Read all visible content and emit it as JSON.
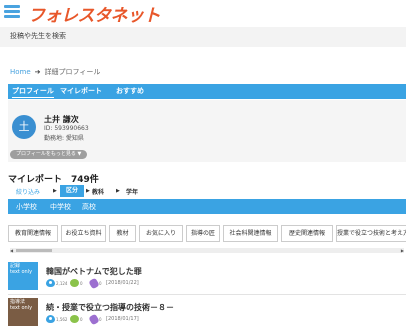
{
  "header": {
    "logo": "フォレスタネット"
  },
  "search": {
    "placeholder": "投稿や先生を検索"
  },
  "breadcrumb": {
    "home": "Home",
    "separator": "➔",
    "current": "詳細プロフィール"
  },
  "tabs": [
    {
      "label": "プロフィール",
      "active": true
    },
    {
      "label": "マイレポート",
      "active": false
    },
    {
      "label": "おすすめ",
      "active": false
    }
  ],
  "profile": {
    "avatar_letter": "土",
    "name": "土井 謙次",
    "id_text": "ID: 593990663",
    "pref_text": "勤務地: 愛知県",
    "more_label": "プロフィールをもっと見る ▼"
  },
  "myreport": {
    "heading": "マイレポート　749件",
    "filter_label": "絞り込み",
    "filter_active": "区分",
    "filter_kyoka": "教科",
    "filter_gakunen": "学年",
    "arrow": "▶"
  },
  "schools": [
    "小学校",
    "中学校",
    "高校"
  ],
  "tags": [
    "教育関連情報",
    "お役立ち資料",
    "教材",
    "お気に入り",
    "指導の匠",
    "社会科関連情報",
    "歴史関連情報",
    "授業で役立つ技術と考え方"
  ],
  "scrollbar": {
    "left": "◀",
    "right": "▶"
  },
  "posts": [
    {
      "thumb_line1": "記録",
      "thumb_line2": "text only",
      "title": "韓国がベトナムで犯した罪",
      "views": "2,124",
      "likes": "0",
      "clips": "0",
      "date": "[2018/01/22]"
    },
    {
      "thumb_line1": "指導法",
      "thumb_line2": "text only",
      "title": "続・授業で役立つ指導の技術－８－",
      "views": "1,562",
      "likes": "0",
      "clips": "0",
      "date": "[2018/01/17]"
    }
  ],
  "colors": {
    "accent_blue": "#3aa3e3",
    "logo_orange": "#e8572a"
  }
}
